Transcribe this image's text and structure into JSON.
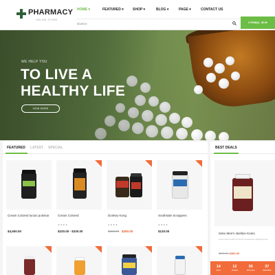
{
  "logo": {
    "name": "PHARMACY",
    "tagline": "ONLINE STORE"
  },
  "nav": [
    {
      "label": "HOME ▾"
    },
    {
      "label": "FEATURED ▾"
    },
    {
      "label": "SHOP ▾"
    },
    {
      "label": "BLOG ▾"
    },
    {
      "label": "PAGE ▾"
    },
    {
      "label": "CONTACT US"
    }
  ],
  "search": {
    "placeholder": "SEARCH"
  },
  "cart": {
    "label": "0 ITEM(S) - $0.00"
  },
  "hero": {
    "kicker": "WE HELP YOU",
    "title_line1": "TO LIVE A",
    "title_line2": "HEALTHY LIFE",
    "button": "VIEW MORE"
  },
  "tabs": [
    "FEATURED",
    "LATEST",
    "SPECIAL"
  ],
  "products": [
    {
      "name": "Cream Colored luctus pulvinar",
      "stars": "",
      "old_price": "",
      "price": "$4,500.00"
    },
    {
      "name": "Cream Colored",
      "stars": "★★★★",
      "old_price": "",
      "price": "$220.00 - $330.00"
    },
    {
      "name": "Donkey Kong",
      "stars": "★★★★",
      "old_price": "$350.00",
      "price": "$250.00"
    },
    {
      "name": "Southside Scrappers",
      "stars": "★★★★",
      "old_price": "",
      "price": "$120.00"
    }
  ],
  "deals": {
    "title": "BEST DEALS",
    "product_name": "Seko Men's skeliton Kneto",
    "description": "Lorem ipsum dolor sit amet consectetur adipiscing elit",
    "old_price": "$390.00",
    "price": "$300.00",
    "countdown": [
      {
        "value": "14",
        "label": "DAYS"
      },
      {
        "value": "12",
        "label": "HOURS"
      },
      {
        "value": "55",
        "label": "MINUTES"
      },
      {
        "value": "37",
        "label": "SECONDS"
      }
    ]
  },
  "colors": {
    "accent": "#6cbd45",
    "sale": "#f26b3a",
    "logo": "#2f5f37"
  }
}
